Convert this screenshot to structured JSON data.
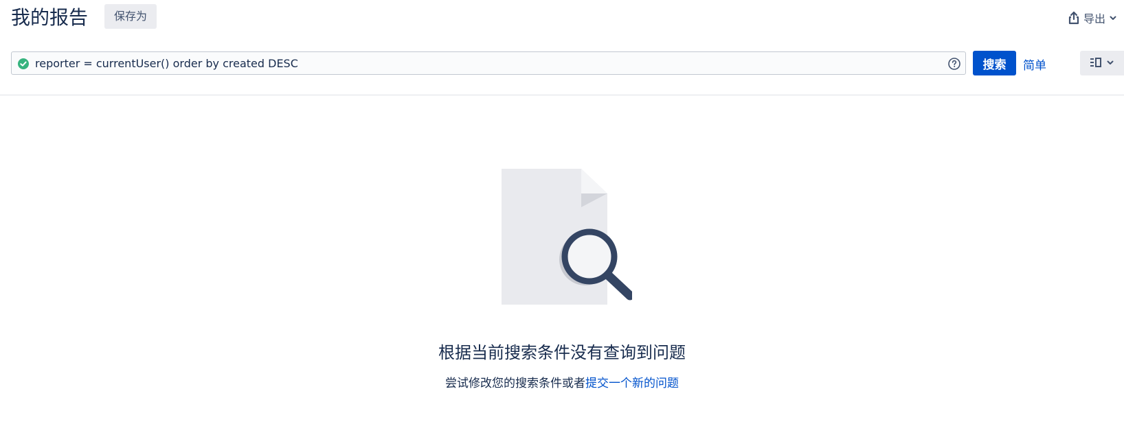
{
  "header": {
    "title": "我的报告",
    "save_as_label": "保存为",
    "export_label": "导出",
    "export_icon": "share-export-icon",
    "export_chevron_icon": "chevron-down-icon"
  },
  "search": {
    "valid_icon": "check-circle-icon",
    "query": "reporter = currentUser() order by created DESC",
    "help_icon": "question-circle-icon",
    "search_button_label": "搜索",
    "basic_link_label": "简单",
    "view_icon": "list-detail-view-icon",
    "view_chevron_icon": "chevron-down-icon"
  },
  "empty_state": {
    "illustration": "document-search-icon",
    "heading": "根据当前搜索条件没有查询到问题",
    "description_prefix": "尝试修改您的搜索条件或者",
    "description_link": "提交一个新的问题"
  },
  "colors": {
    "primary": "#0052cc",
    "text": "#172b4d",
    "subtle_bg": "#ebecf0",
    "valid_green": "#36b37e",
    "illustration_dark": "#344563"
  }
}
